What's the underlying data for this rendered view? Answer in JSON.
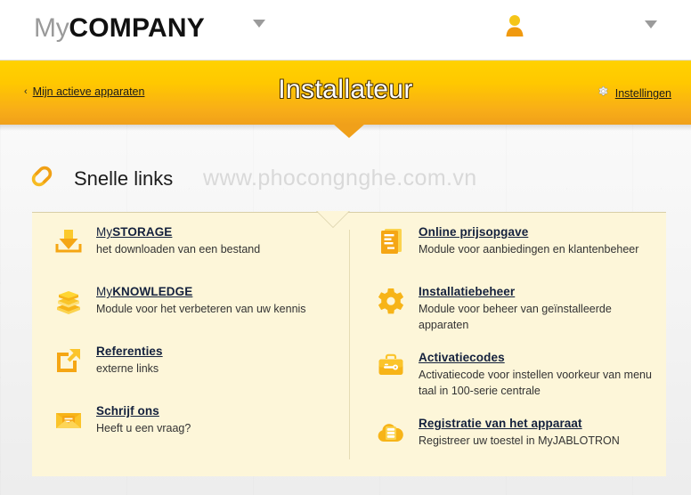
{
  "header": {
    "logo_my": "My",
    "logo_company": "COMPANY",
    "logo_caret_icon": "chevron-down-icon",
    "user_icon": "user-avatar-icon",
    "right_caret_icon": "chevron-down-icon"
  },
  "band": {
    "back_chevron": "‹",
    "back_label": "Mijn actieve apparaten",
    "title": "Installateur",
    "settings_label": "Instellingen",
    "settings_icon": "gear-icon"
  },
  "watermark": "www.phocongnghe.com.vn",
  "section": {
    "icon": "chain-link-icon",
    "title": "Snelle links"
  },
  "links": {
    "left": [
      {
        "icon": "download-icon",
        "title_thin": "My",
        "title_bold": "STORAGE",
        "desc": "het downloaden van een bestand"
      },
      {
        "icon": "books-icon",
        "title_thin": "My",
        "title_bold": "KNOWLEDGE",
        "desc": "Module voor het verbeteren van uw kennis"
      },
      {
        "icon": "external-link-icon",
        "title_thin": "",
        "title_bold": "Referenties",
        "desc": "externe links"
      },
      {
        "icon": "envelope-icon",
        "title_thin": "",
        "title_bold": "Schrijf ons",
        "desc": "Heeft u een vraag?"
      }
    ],
    "right": [
      {
        "icon": "document-icon",
        "title_thin": "",
        "title_bold": "Online prijsopgave",
        "desc": "Module voor aanbiedingen en klantenbeheer"
      },
      {
        "icon": "gear-icon",
        "title_thin": "",
        "title_bold": "Installatiebeheer",
        "desc": "Module voor beheer van geïnstalleerde apparaten"
      },
      {
        "icon": "briefcase-key-icon",
        "title_thin": "",
        "title_bold": "Activatiecodes",
        "desc": "Activatiecode voor instellen voorkeur van menu taal in 100-serie centrale"
      },
      {
        "icon": "cloud-server-icon",
        "title_thin": "",
        "title_bold": "Registratie van het apparaat",
        "desc": "Registreer uw toestel in MyJABLOTRON"
      }
    ]
  },
  "colors": {
    "brand_yellow": "#ffc800",
    "brand_orange": "#f0a01a",
    "card_cream": "#fdf6d9",
    "link_navy": "#14213d"
  }
}
